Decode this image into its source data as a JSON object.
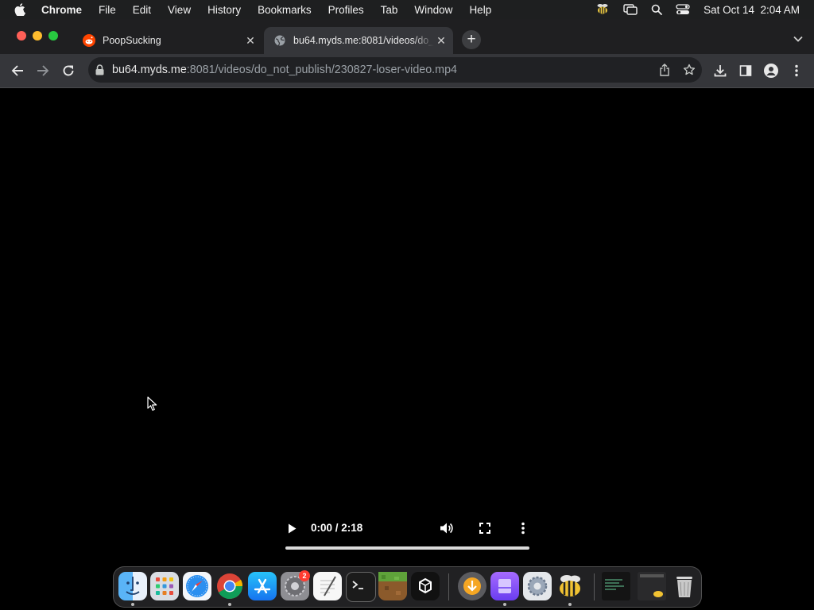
{
  "menubar": {
    "app": "Chrome",
    "items": [
      "File",
      "Edit",
      "View",
      "History",
      "Bookmarks",
      "Profiles",
      "Tab",
      "Window",
      "Help"
    ],
    "datetime": "Sat Oct 14  2:04 AM"
  },
  "tabs": [
    {
      "title": "PoopSucking",
      "favicon": "reddit-icon",
      "active": false
    },
    {
      "title": "bu64.myds.me:8081/videos/do_not_publish/230827-loser-video.mp4",
      "favicon": "globe-icon",
      "active": true
    }
  ],
  "omnibox": {
    "host": "bu64.myds.me",
    "rest": ":8081/videos/do_not_publish/230827-loser-video.mp4"
  },
  "video": {
    "time": "0:00 / 2:18",
    "progress": 0.0
  },
  "dock": {
    "badge_count": "2"
  },
  "colors": {
    "menubar": "#1e1f20",
    "tabstrip": "#1f1f21",
    "toolbar": "#35363a",
    "omnibox": "#202124",
    "reddit": "#ff4500"
  }
}
